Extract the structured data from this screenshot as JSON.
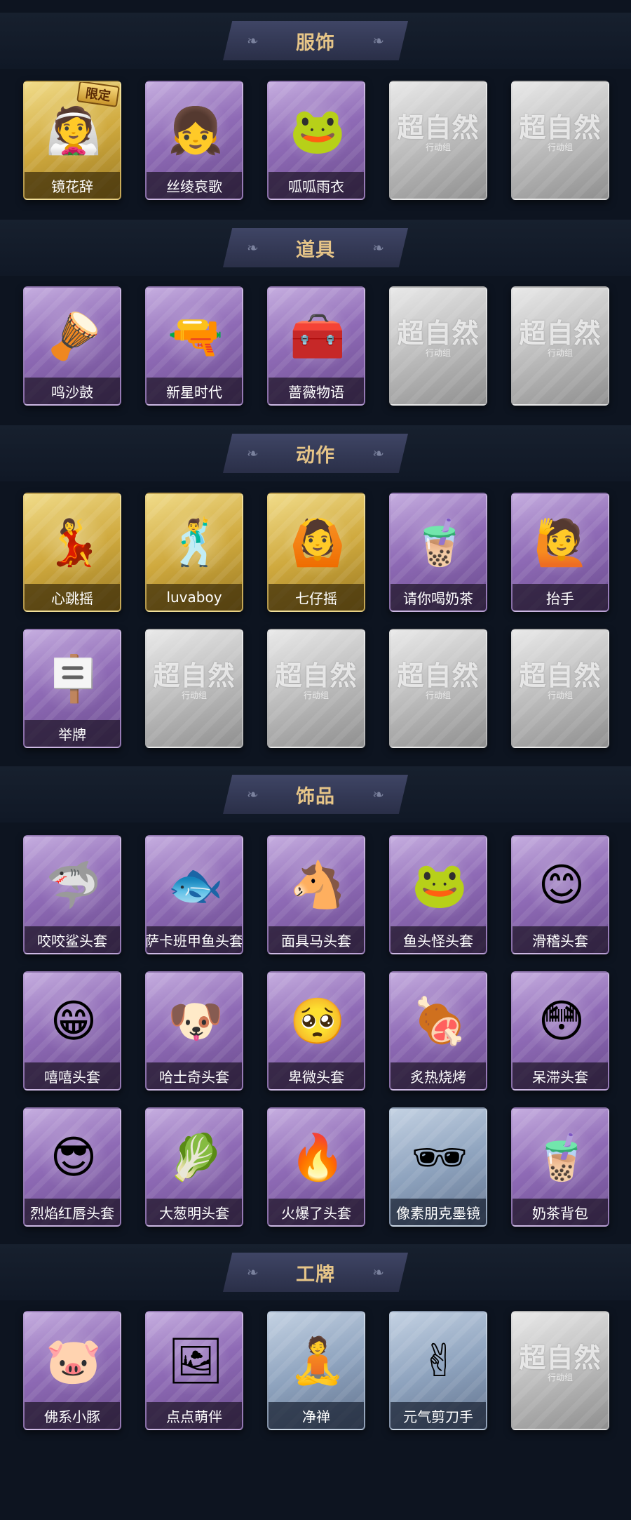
{
  "sections": [
    {
      "title": "服饰",
      "items": [
        {
          "label": "镜花辞",
          "rarity": "gold",
          "icon": "👰",
          "badge": "限定"
        },
        {
          "label": "丝绫哀歌",
          "rarity": "purple",
          "icon": "👧"
        },
        {
          "label": "呱呱雨衣",
          "rarity": "purple",
          "icon": "🐸"
        },
        {
          "locked": true,
          "watermark": "超自然",
          "watermark_sub": "行动组"
        },
        {
          "locked": true,
          "watermark": "超自然",
          "watermark_sub": "行动组"
        }
      ]
    },
    {
      "title": "道具",
      "items": [
        {
          "label": "鸣沙鼓",
          "rarity": "purple",
          "icon": "🪘"
        },
        {
          "label": "新星时代",
          "rarity": "purple",
          "icon": "🔫"
        },
        {
          "label": "蔷薇物语",
          "rarity": "purple",
          "icon": "🧰"
        },
        {
          "locked": true,
          "watermark": "超自然",
          "watermark_sub": "行动组"
        },
        {
          "locked": true,
          "watermark": "超自然",
          "watermark_sub": "行动组"
        }
      ]
    },
    {
      "title": "动作",
      "items": [
        {
          "label": "心跳摇",
          "rarity": "gold",
          "icon": "💃"
        },
        {
          "label": "luvaboy",
          "rarity": "gold",
          "icon": "🕺"
        },
        {
          "label": "七仔摇",
          "rarity": "gold",
          "icon": "🙆"
        },
        {
          "label": "请你喝奶茶",
          "rarity": "purple",
          "icon": "🧋"
        },
        {
          "label": "抬手",
          "rarity": "purple",
          "icon": "🙋"
        },
        {
          "label": "举牌",
          "rarity": "purple",
          "icon": "🪧"
        },
        {
          "locked": true,
          "watermark": "超自然",
          "watermark_sub": "行动组"
        },
        {
          "locked": true,
          "watermark": "超自然",
          "watermark_sub": "行动组"
        },
        {
          "locked": true,
          "watermark": "超自然",
          "watermark_sub": "行动组"
        },
        {
          "locked": true,
          "watermark": "超自然",
          "watermark_sub": "行动组"
        }
      ]
    },
    {
      "title": "饰品",
      "items": [
        {
          "label": "咬咬鲨头套",
          "rarity": "purple",
          "icon": "🦈"
        },
        {
          "label": "萨卡班甲鱼头套",
          "rarity": "purple",
          "icon": "🐟"
        },
        {
          "label": "面具马头套",
          "rarity": "purple",
          "icon": "🐴"
        },
        {
          "label": "鱼头怪头套",
          "rarity": "purple",
          "icon": "🐸"
        },
        {
          "label": "滑稽头套",
          "rarity": "purple",
          "icon": "😊"
        },
        {
          "label": "嘻嘻头套",
          "rarity": "purple",
          "icon": "😁"
        },
        {
          "label": "哈士奇头套",
          "rarity": "purple",
          "icon": "🐶"
        },
        {
          "label": "卑微头套",
          "rarity": "purple",
          "icon": "🥺"
        },
        {
          "label": "炙热烧烤",
          "rarity": "purple",
          "icon": "🍖"
        },
        {
          "label": "呆滞头套",
          "rarity": "purple",
          "icon": "😳"
        },
        {
          "label": "烈焰红唇头套",
          "rarity": "purple",
          "icon": "😎"
        },
        {
          "label": "大葱明头套",
          "rarity": "purple",
          "icon": "🥬"
        },
        {
          "label": "火爆了头套",
          "rarity": "purple",
          "icon": "🔥"
        },
        {
          "label": "像素朋克墨镜",
          "rarity": "blue",
          "icon": "🕶"
        },
        {
          "label": "奶茶背包",
          "rarity": "purple",
          "icon": "🧋"
        }
      ]
    },
    {
      "title": "工牌",
      "items": [
        {
          "label": "佛系小豚",
          "rarity": "purple",
          "icon": "🐷"
        },
        {
          "label": "点点萌伴",
          "rarity": "purple",
          "icon": "🖼"
        },
        {
          "label": "净禅",
          "rarity": "blue",
          "icon": "🧘"
        },
        {
          "label": "元气剪刀手",
          "rarity": "blue",
          "icon": "✌"
        },
        {
          "locked": true,
          "watermark": "超自然",
          "watermark_sub": "行动组"
        }
      ]
    }
  ],
  "colors": {
    "background": "#0d1420",
    "title_text": "#e6c588",
    "rarity_gold": "#d9b54a",
    "rarity_purple": "#8f6bb6",
    "rarity_blue": "#8ea3be",
    "rarity_locked": "#bdbdbd"
  }
}
